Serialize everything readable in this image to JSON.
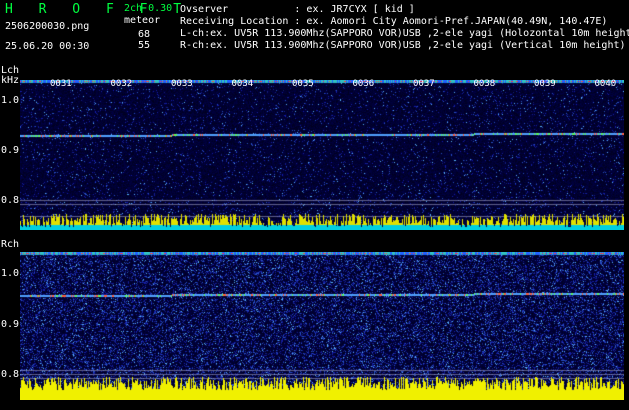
{
  "header": {
    "brand": "H R O F F T",
    "ch_label": "2ch 0.30",
    "filename": "2506200030.png",
    "meteor_label": "meteor",
    "datetime": "25.06.20 00:30",
    "meteor_l": "68",
    "meteor_r": "55",
    "observer_line": "Ovserver           : ex. JR7CYX [ kid ]",
    "location_line": "Receiving Location : ex. Aomori City Aomori-Pref.JAPAN(40.49N, 140.47E)",
    "lch_line": "L-ch:ex. UV5R 113.900Mhz(SAPPORO VOR)USB ,2-ele yagi (Holozontal 10m height)",
    "rch_line": "R-ch:ex. UV5R 113.900Mhz(SAPPORO VOR)USB ,2-ele yagi (Vertical 10m height)"
  },
  "time_ticks": [
    "0031",
    "0032",
    "0033",
    "0034",
    "0035",
    "0036",
    "0037",
    "0038",
    "0039",
    "0040"
  ],
  "lch": {
    "channel_label": "Lch",
    "unit_label": "kHz",
    "y_ticks": [
      "1.0",
      "0.9",
      "0.8"
    ]
  },
  "rch": {
    "channel_label": "Rch",
    "y_ticks": [
      "1.0",
      "0.9",
      "0.8"
    ]
  },
  "colors": {
    "header_green": "#00ff40",
    "bg_noise_dark": "#000040",
    "signal_line": "#40a0ff",
    "meteor_bar": "#ffff00",
    "meteor_base": "#00ffff"
  }
}
